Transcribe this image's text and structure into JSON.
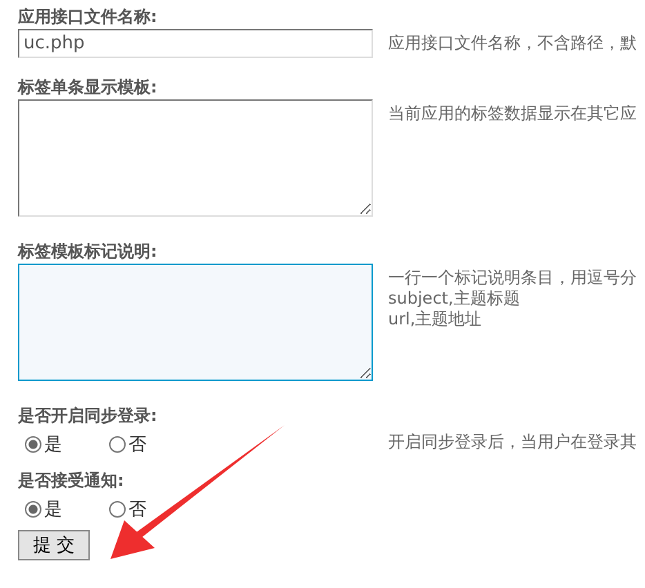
{
  "fields": [
    {
      "kind": "text",
      "label": "应用接口文件名称:",
      "value": "uc.php",
      "description": [
        "应用接口文件名称，不含路径，默"
      ]
    },
    {
      "kind": "textarea",
      "label": "标签单条显示模板:",
      "focused": false,
      "description": [
        "当前应用的标签数据显示在其它应"
      ]
    },
    {
      "kind": "textarea",
      "label": "标签模板标记说明:",
      "focused": true,
      "description": [
        "一行一个标记说明条目，用逗号分",
        "subject,主题标题",
        "url,主题地址"
      ]
    },
    {
      "kind": "radio",
      "label": "是否开启同步登录:",
      "options": [
        {
          "label": "是",
          "selected": true
        },
        {
          "label": "否",
          "selected": false
        }
      ],
      "description": [
        "开启同步登录后，当用户在登录其"
      ]
    },
    {
      "kind": "radio",
      "label": "是否接受通知:",
      "options": [
        {
          "label": "是",
          "selected": true
        },
        {
          "label": "否",
          "selected": false
        }
      ]
    }
  ],
  "submit": "提 交"
}
